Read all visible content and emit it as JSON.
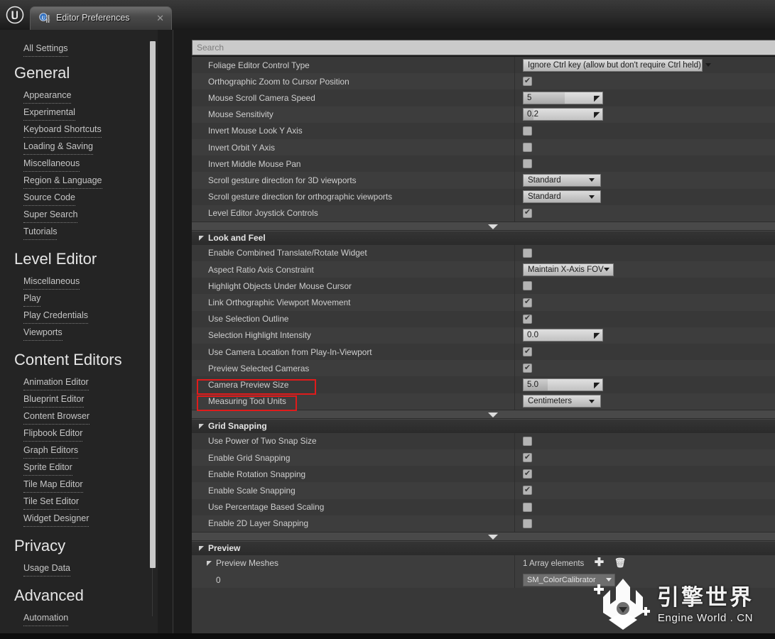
{
  "window": {
    "logo_icon": "unreal-engine-logo",
    "tab_title": "Editor Preferences",
    "tab_icon": "preferences-icon",
    "close_icon": "close-icon"
  },
  "sidebar": {
    "all_settings": "All Settings",
    "groups": [
      {
        "title": "General",
        "items": [
          {
            "label": "Appearance"
          },
          {
            "label": "Experimental"
          },
          {
            "label": "Keyboard Shortcuts"
          },
          {
            "label": "Loading & Saving"
          },
          {
            "label": "Miscellaneous"
          },
          {
            "label": "Region & Language"
          },
          {
            "label": "Source Code"
          },
          {
            "label": "Super Search"
          },
          {
            "label": "Tutorials"
          }
        ]
      },
      {
        "title": "Level Editor",
        "items": [
          {
            "label": "Miscellaneous"
          },
          {
            "label": "Play"
          },
          {
            "label": "Play Credentials"
          },
          {
            "label": "Viewports",
            "expandable": true
          }
        ]
      },
      {
        "title": "Content Editors",
        "items": [
          {
            "label": "Animation Editor"
          },
          {
            "label": "Blueprint Editor"
          },
          {
            "label": "Content Browser"
          },
          {
            "label": "Flipbook Editor"
          },
          {
            "label": "Graph Editors"
          },
          {
            "label": "Sprite Editor"
          },
          {
            "label": "Tile Map Editor"
          },
          {
            "label": "Tile Set Editor"
          },
          {
            "label": "Widget Designer"
          }
        ]
      },
      {
        "title": "Privacy",
        "items": [
          {
            "label": "Usage Data"
          }
        ]
      },
      {
        "title": "Advanced",
        "items": [
          {
            "label": "Automation"
          }
        ]
      }
    ]
  },
  "search": {
    "placeholder": "Search",
    "value": ""
  },
  "properties": {
    "top_rows": [
      {
        "label": "Foliage Editor Control Type",
        "type": "combo",
        "value": "Ignore Ctrl key (allow but don't require Ctrl held)",
        "width": "w250"
      },
      {
        "label": "Orthographic Zoom to Cursor Position",
        "type": "checkbox",
        "checked": true
      },
      {
        "label": "Mouse Scroll Camera Speed",
        "type": "spinner",
        "value": "5",
        "fill_pct": 52
      },
      {
        "label": "Mouse Sensitivity",
        "type": "spinner",
        "value": "0.2",
        "fill_pct": 13
      },
      {
        "label": "Invert Mouse Look Y Axis",
        "type": "checkbox",
        "checked": false
      },
      {
        "label": "Invert Orbit Y Axis",
        "type": "checkbox",
        "checked": false
      },
      {
        "label": "Invert Middle Mouse Pan",
        "type": "checkbox",
        "checked": false
      },
      {
        "label": "Scroll gesture direction for 3D viewports",
        "type": "combo",
        "value": "Standard",
        "width": "w110"
      },
      {
        "label": "Scroll gesture direction for orthographic viewports",
        "type": "combo",
        "value": "Standard",
        "width": "w110"
      },
      {
        "label": "Level Editor Joystick Controls",
        "type": "checkbox",
        "checked": true
      }
    ],
    "look_and_feel": {
      "title": "Look and Feel",
      "rows": [
        {
          "label": "Enable Combined Translate/Rotate Widget",
          "type": "checkbox",
          "checked": false
        },
        {
          "label": "Aspect Ratio Axis Constraint",
          "type": "combo",
          "value": "Maintain X-Axis FOV",
          "width": "w128"
        },
        {
          "label": "Highlight Objects Under Mouse Cursor",
          "type": "checkbox",
          "checked": false
        },
        {
          "label": "Link Orthographic Viewport Movement",
          "type": "checkbox",
          "checked": true
        },
        {
          "label": "Use Selection Outline",
          "type": "checkbox",
          "checked": true
        },
        {
          "label": "Selection Highlight Intensity",
          "type": "spinner",
          "value": "0.0",
          "fill_pct": 0
        },
        {
          "label": "Use Camera Location from Play-In-Viewport",
          "type": "checkbox",
          "checked": true
        },
        {
          "label": "Preview Selected Cameras",
          "type": "checkbox",
          "checked": true,
          "highlighted": true
        },
        {
          "label": "Camera Preview Size",
          "type": "spinner",
          "value": "5.0",
          "fill_pct": 31,
          "highlighted": true
        },
        {
          "label": "Measuring Tool Units",
          "type": "combo",
          "value": "Centimeters",
          "width": "w110"
        }
      ]
    },
    "grid_snapping": {
      "title": "Grid Snapping",
      "rows": [
        {
          "label": "Use Power of Two Snap Size",
          "type": "checkbox",
          "checked": false
        },
        {
          "label": "Enable Grid Snapping",
          "type": "checkbox",
          "checked": true
        },
        {
          "label": "Enable Rotation Snapping",
          "type": "checkbox",
          "checked": true
        },
        {
          "label": "Enable Scale Snapping",
          "type": "checkbox",
          "checked": true
        },
        {
          "label": "Use Percentage Based Scaling",
          "type": "checkbox",
          "checked": false
        },
        {
          "label": "Enable 2D Layer Snapping",
          "type": "checkbox",
          "checked": false
        }
      ]
    },
    "preview": {
      "title": "Preview",
      "sub_title": "Preview Meshes",
      "array_count": "1 Array elements",
      "add_icon": "plus-icon",
      "delete_icon": "trash-icon",
      "elements": [
        {
          "index": "0",
          "value": "SM_ColorCalibrator"
        }
      ]
    }
  },
  "watermark": {
    "cn": "引擎世界",
    "en": "Engine World . CN",
    "icon": "engine-world-logo"
  },
  "colors": {
    "panel_bg": "#383838",
    "row_alt": "#3d3d3d",
    "accent_red": "#e01b1b",
    "text": "#cfcfcf"
  }
}
